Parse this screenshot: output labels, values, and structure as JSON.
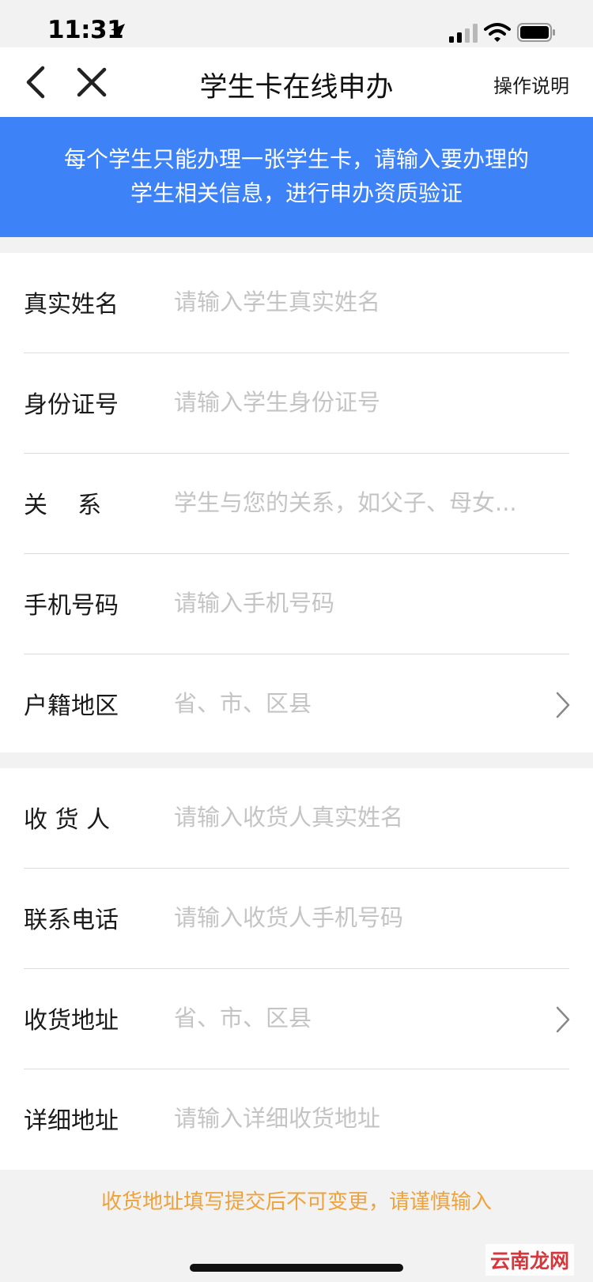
{
  "status_bar": {
    "time": "11:31",
    "icons": [
      "location-arrow-icon",
      "cellular-signal-icon",
      "wifi-icon",
      "battery-icon"
    ]
  },
  "nav": {
    "title": "学生卡在线申办",
    "help_link": "操作说明",
    "icons": [
      "chevron-left-icon",
      "close-icon"
    ]
  },
  "banner": {
    "line1": "每个学生只能办理一张学生卡，请输入要办理的",
    "line2": "学生相关信息，进行申办资质验证",
    "color": "#3e82f7"
  },
  "student_section": {
    "fields": [
      {
        "label": "真实姓名",
        "placeholder": "请输入学生真实姓名"
      },
      {
        "label": "身份证号",
        "placeholder": "请输入学生身份证号"
      },
      {
        "label": "关    系",
        "placeholder": "学生与您的关系，如父子、母女..."
      },
      {
        "label": "手机号码",
        "placeholder": "请输入手机号码"
      },
      {
        "label": "户籍地区",
        "placeholder": "省、市、区县"
      }
    ]
  },
  "delivery_section": {
    "fields": [
      {
        "label": "收 货 人",
        "placeholder": "请输入收货人真实姓名"
      },
      {
        "label": "联系电话",
        "placeholder": "请输入收货人手机号码"
      },
      {
        "label": "收货地址",
        "placeholder": "省、市、区县"
      },
      {
        "label": "详细地址",
        "placeholder": "请输入详细收货地址"
      }
    ]
  },
  "warning": {
    "text": "收货地址填写提交后不可变更，请谨慎输入",
    "color": "#f0a23a"
  },
  "watermark": "云南龙网"
}
